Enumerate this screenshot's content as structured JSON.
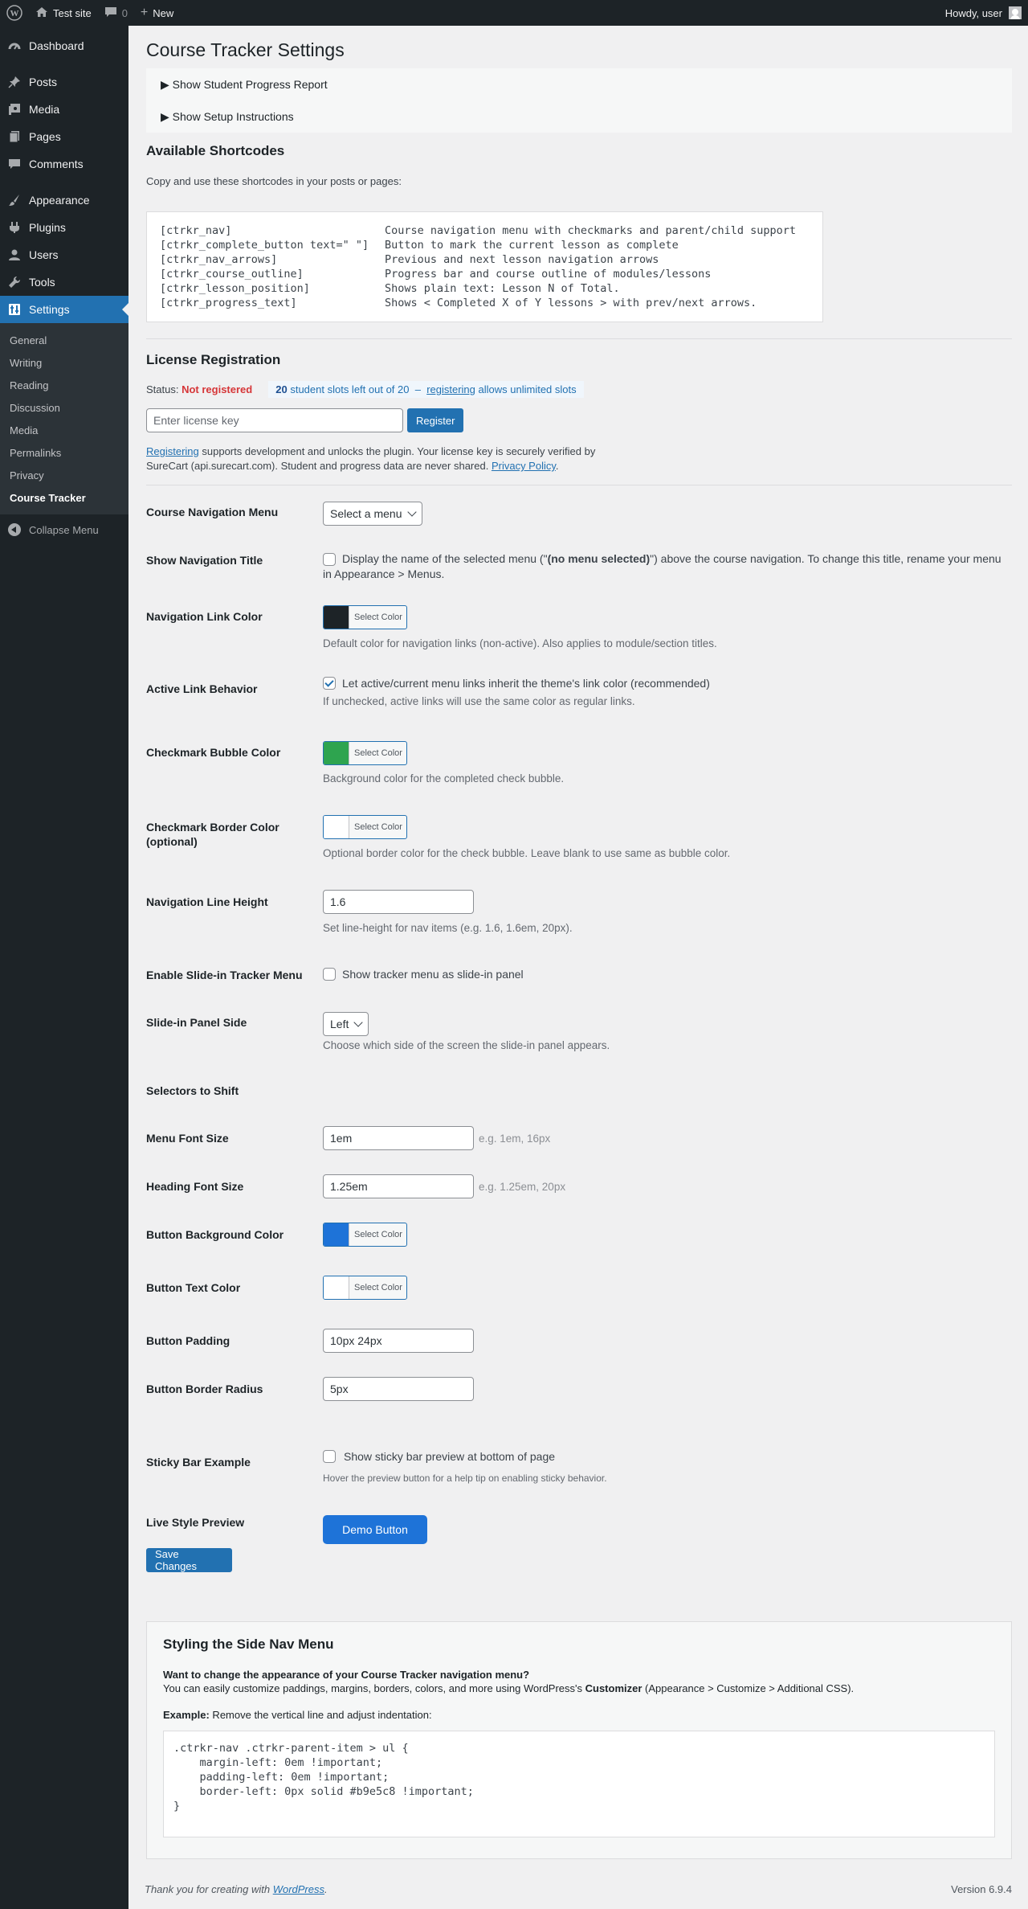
{
  "adminbar": {
    "site_name": "Test site",
    "comments_count": "0",
    "new_label": "New",
    "howdy": "Howdy, user"
  },
  "sidebar": {
    "items": [
      {
        "label": "Dashboard",
        "icon": "dashboard-icon"
      },
      {
        "label": "Posts",
        "icon": "pushpin-icon"
      },
      {
        "label": "Media",
        "icon": "media-icon"
      },
      {
        "label": "Pages",
        "icon": "pages-icon"
      },
      {
        "label": "Comments",
        "icon": "comment-icon"
      },
      {
        "label": "Appearance",
        "icon": "brush-icon"
      },
      {
        "label": "Plugins",
        "icon": "plugin-icon"
      },
      {
        "label": "Users",
        "icon": "users-icon"
      },
      {
        "label": "Tools",
        "icon": "wrench-icon"
      },
      {
        "label": "Settings",
        "icon": "settings-icon"
      }
    ],
    "submenu": [
      "General",
      "Writing",
      "Reading",
      "Discussion",
      "Media",
      "Permalinks",
      "Privacy",
      "Course Tracker"
    ],
    "collapse": "Collapse Menu"
  },
  "page": {
    "title": "Course Tracker Settings",
    "disclosures": [
      "▶ Show Student Progress Report",
      "▶ Show Setup Instructions"
    ]
  },
  "shortcodes": {
    "heading": "Available Shortcodes",
    "intro": "Copy and use these shortcodes in your posts or pages:",
    "rows": [
      {
        "code": "[ctrkr_nav]",
        "desc": "Course navigation menu with checkmarks and parent/child support"
      },
      {
        "code": "[ctrkr_complete_button text=\" \"]",
        "desc": "Button to mark the current lesson as complete"
      },
      {
        "code": "[ctrkr_nav_arrows]",
        "desc": "Previous and next lesson navigation arrows"
      },
      {
        "code": "[ctrkr_course_outline]",
        "desc": "Progress bar and course outline of modules/lessons"
      },
      {
        "code": "[ctrkr_lesson_position]",
        "desc": "Shows plain text: Lesson N of Total."
      },
      {
        "code": "[ctrkr_progress_text]",
        "desc": "Shows < Completed X of Y lessons > with prev/next arrows."
      }
    ]
  },
  "license": {
    "heading": "License Registration",
    "status_label": "Status:",
    "status_value": "Not registered",
    "slots_count": "20",
    "slots_text": "student slots left out of 20",
    "slots_dash": "–",
    "slots_link": "registering",
    "slots_tail": "allows unlimited slots",
    "placeholder": "Enter license key",
    "register_button": "Register",
    "note_link": "Registering",
    "note_text1": "supports development and unlocks the plugin. Your license key is securely verified by",
    "note_text2": "SureCart (api.surecart.com). Student and progress data are never shared.",
    "privacy_link": "Privacy Policy",
    "note_end": "."
  },
  "settings": {
    "nav_menu": {
      "label": "Course Navigation Menu",
      "value": "Select a menu"
    },
    "show_title": {
      "label": "Show Navigation Title",
      "text_pre": "Display the name of the selected menu (\"",
      "text_bold": "(no menu selected)",
      "text_post": "\") above the course navigation. To change this title, rename your menu",
      "text_line2": "in Appearance > Menus."
    },
    "link_color": {
      "label": "Navigation Link Color",
      "button": "Select Color",
      "swatch": "#1d2327",
      "desc": "Default color for navigation links (non-active). Also applies to module/section titles."
    },
    "active_behavior": {
      "label": "Active Link Behavior",
      "checkbox": "Let active/current menu links inherit the theme's link color (recommended)",
      "desc": "If unchecked, active links will use the same color as regular links."
    },
    "bubble_color": {
      "label": "Checkmark Bubble Color",
      "button": "Select Color",
      "swatch": "#2ea44f",
      "desc": "Background color for the completed check bubble."
    },
    "border_color": {
      "label1": "Checkmark Border Color",
      "label2": "(optional)",
      "button": "Select Color",
      "swatch": "#ffffff",
      "desc": "Optional border color for the check bubble. Leave blank to use same as bubble color."
    },
    "line_height": {
      "label": "Navigation Line Height",
      "value": "1.6",
      "desc": "Set line-height for nav items (e.g. 1.6, 1.6em, 20px)."
    },
    "slide_in": {
      "label": "Enable Slide-in Tracker Menu",
      "checkbox": "Show tracker menu as slide-in panel"
    },
    "panel_side": {
      "label": "Slide-in Panel Side",
      "value": "Left",
      "desc": "Choose which side of the screen the slide-in panel appears."
    },
    "selectors": {
      "label": "Selectors to Shift"
    },
    "menu_font": {
      "label": "Menu Font Size",
      "value": "1em",
      "hint": "e.g. 1em, 16px"
    },
    "heading_font": {
      "label": "Heading Font Size",
      "value": "1.25em",
      "hint": "e.g. 1.25em, 20px"
    },
    "btn_bg": {
      "label": "Button Background Color",
      "button": "Select Color",
      "swatch": "#1e73d8"
    },
    "btn_text": {
      "label": "Button Text Color",
      "button": "Select Color",
      "swatch": "#ffffff"
    },
    "btn_padding": {
      "label": "Button Padding",
      "value": "10px 24px"
    },
    "btn_radius": {
      "label": "Button Border Radius",
      "value": "5px"
    },
    "sticky": {
      "label": "Sticky Bar Example",
      "checkbox": "Show sticky bar preview at bottom of page",
      "desc": "Hover the preview button for a help tip on enabling sticky behavior."
    },
    "preview": {
      "label": "Live Style Preview",
      "button": "Demo Button"
    },
    "save": "Save Changes"
  },
  "styling": {
    "heading": "Styling the Side Nav Menu",
    "q": "Want to change the appearance of your Course Tracker navigation menu?",
    "line_pre": "You can easily customize paddings, margins, borders, colors, and more using WordPress's ",
    "line_bold": "Customizer",
    "line_post": " (Appearance > Customize > Additional CSS).",
    "example_label": "Example:",
    "example_text": " Remove the vertical line and adjust indentation:",
    "code": ".ctrkr-nav .ctrkr-parent-item > ul {\n    margin-left: 0em !important;\n    padding-left: 0em !important;\n    border-left: 0px solid #b9e5c8 !important;\n}"
  },
  "footer": {
    "thanks": "Thank you for creating with",
    "wp_link": "WordPress",
    "period": ".",
    "version": "Version 6.9.4"
  }
}
